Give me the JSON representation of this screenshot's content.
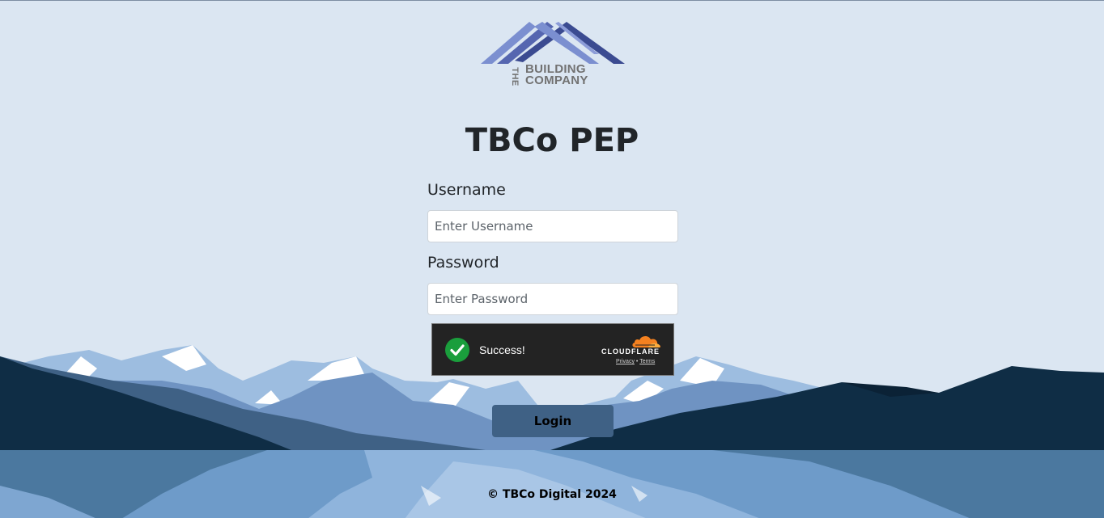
{
  "brand": {
    "logo_line1": "BUILDING",
    "logo_line2": "COMPANY",
    "logo_prefix": "THE",
    "colors": {
      "logo_dark": "#3b4b91",
      "logo_light": "#7b8fd0",
      "logo_text": "#727272"
    }
  },
  "page": {
    "title": "TBCo PEP"
  },
  "form": {
    "username_label": "Username",
    "username_placeholder": "Enter Username",
    "password_label": "Password",
    "password_placeholder": "Enter Password",
    "login_label": "Login"
  },
  "captcha": {
    "status": "Success!",
    "brand": "CLOUDFLARE",
    "privacy_link": "Privacy",
    "separator": "•",
    "terms_link": "Terms",
    "icons": [
      "check-icon",
      "cloudflare-cloud-icon"
    ]
  },
  "footer": {
    "text": "© TBCo Digital 2024"
  },
  "colors": {
    "background": "#dbe6f2",
    "button": "#3f6185",
    "success": "#1a9e3c",
    "mountain_dark": "#0f2d45",
    "lake": "#6e9bc9"
  }
}
